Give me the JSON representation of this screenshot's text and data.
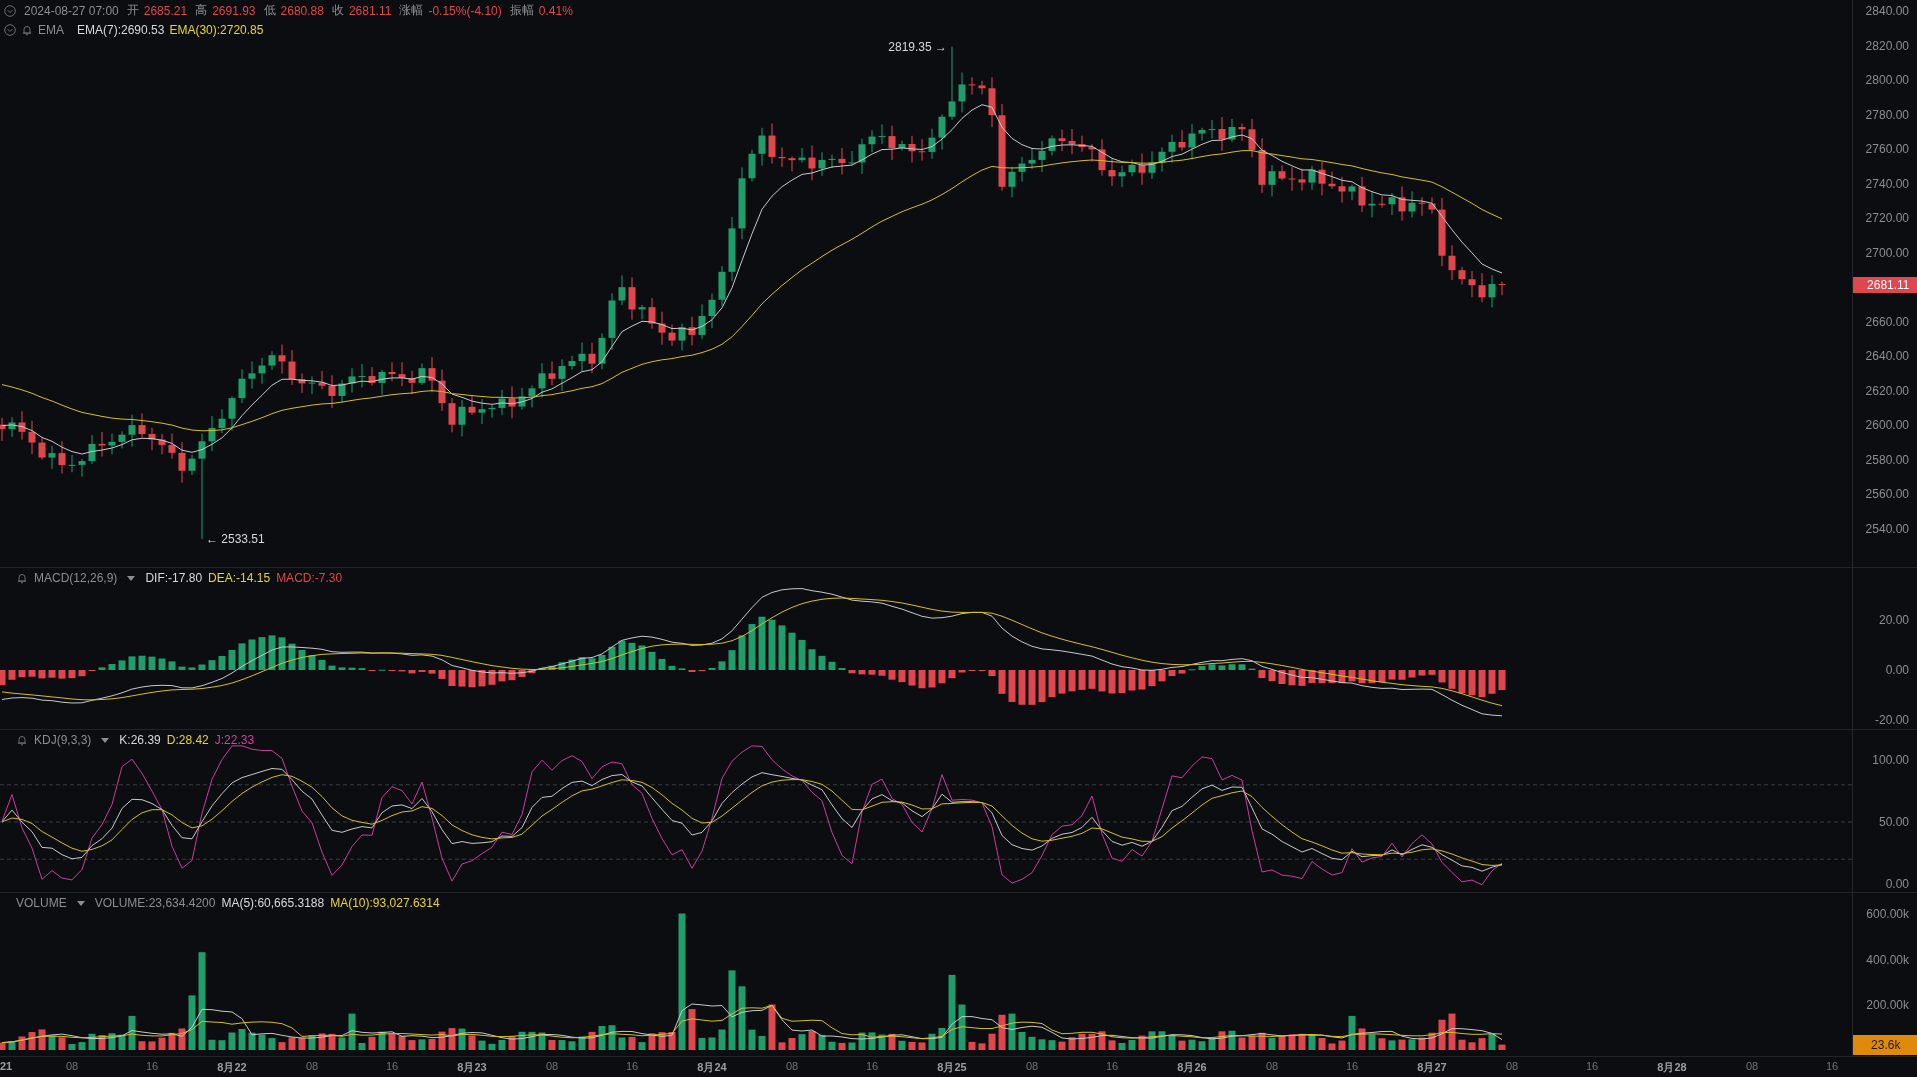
{
  "header": {
    "datetime": "2024-08-27 07:00",
    "ohlc": [
      {
        "label": "开",
        "value": "2685.21"
      },
      {
        "label": "高",
        "value": "2691.93"
      },
      {
        "label": "低",
        "value": "2680.88"
      },
      {
        "label": "收",
        "value": "2681.11"
      },
      {
        "label": "涨幅",
        "value": "-0.15%(-4.10)"
      },
      {
        "label": "振幅",
        "value": "0.41%"
      }
    ]
  },
  "price_pane": {
    "indicator": "EMA",
    "values": [
      {
        "text": "EMA(7):2690.53",
        "color": "#d9d9d9"
      },
      {
        "text": "EMA(30):2720.85",
        "color": "#e8d52a"
      }
    ],
    "axis": [
      "2840.00",
      "2820.00",
      "2800.00",
      "2780.00",
      "2760.00",
      "2740.00",
      "2720.00",
      "2700.00",
      "2660.00",
      "2640.00",
      "2620.00",
      "2600.00",
      "2580.00",
      "2560.00",
      "2540.00"
    ],
    "current_price": "2681.11",
    "high_marker": "2819.35 →",
    "low_marker": "← 2533.51"
  },
  "macd_pane": {
    "indicator": "MACD(12,26,9)",
    "values": [
      {
        "text": "DIF:-17.80",
        "color": "#d9d9d9"
      },
      {
        "text": "DEA:-14.15",
        "color": "#e8d52a"
      },
      {
        "text": "MACD:-7.30",
        "color": "#e0464e"
      }
    ],
    "axis": [
      "20.00",
      "0.00",
      "-20.00"
    ]
  },
  "kdj_pane": {
    "indicator": "KDJ(9,3,3)",
    "values": [
      {
        "text": "K:26.39",
        "color": "#d9d9d9"
      },
      {
        "text": "D:28.42",
        "color": "#e8d52a"
      },
      {
        "text": "J:22.33",
        "color": "#d63fa4"
      }
    ],
    "axis": [
      "100.00",
      "50.00",
      "0.00"
    ]
  },
  "volume_pane": {
    "indicator": "VOLUME",
    "values": [
      {
        "text": "VOLUME:23,634.4200",
        "color": "#8a8d93"
      },
      {
        "text": "MA(5):60,665.3188",
        "color": "#d9d9d9"
      },
      {
        "text": "MA(10):93,027.6314",
        "color": "#e8d52a"
      }
    ],
    "axis": [
      "600.00k",
      "400.00k",
      "200.00k"
    ],
    "current_volume": "23.6k"
  },
  "time_axis": [
    "21",
    "08",
    "16",
    "8月22",
    "08",
    "16",
    "8月23",
    "08",
    "16",
    "8月24",
    "08",
    "16",
    "8月25",
    "08",
    "16",
    "8月26",
    "08",
    "16",
    "8月27",
    "08",
    "16",
    "8月28",
    "08",
    "16"
  ]
}
